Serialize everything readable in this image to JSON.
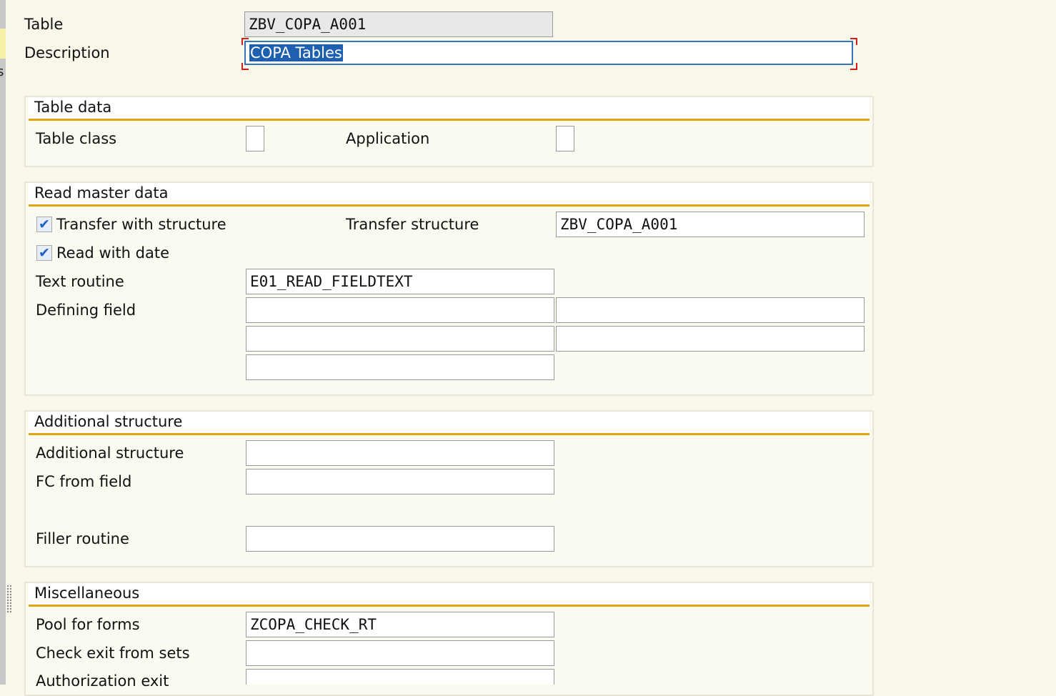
{
  "header": {
    "table_label": "Table",
    "table_value": "ZBV_COPA_A001",
    "description_label": "Description",
    "description_value": "COPA Tables"
  },
  "table_data": {
    "title": "Table data",
    "table_class_label": "Table class",
    "table_class_value": "",
    "application_label": "Application",
    "application_value": ""
  },
  "read_master_data": {
    "title": "Read master data",
    "transfer_with_structure_label": "Transfer with structure",
    "transfer_with_structure_checked": true,
    "read_with_date_label": "Read with date",
    "read_with_date_checked": true,
    "transfer_structure_label": "Transfer structure",
    "transfer_structure_value": "ZBV_COPA_A001",
    "text_routine_label": "Text routine",
    "text_routine_value": "E01_READ_FIELDTEXT",
    "defining_field_label": "Defining field",
    "defining_field_values": [
      "",
      "",
      "",
      "",
      ""
    ]
  },
  "additional_structure": {
    "title": "Additional structure",
    "additional_structure_label": "Additional structure",
    "additional_structure_value": "",
    "fc_from_field_label": "FC from field",
    "fc_from_field_value": "",
    "filler_routine_label": "Filler routine",
    "filler_routine_value": ""
  },
  "miscellaneous": {
    "title": "Miscellaneous",
    "pool_for_forms_label": "Pool for forms",
    "pool_for_forms_value": "ZCOPA_CHECK_RT",
    "check_exit_from_sets_label": "Check exit from sets",
    "check_exit_from_sets_value": "",
    "authorization_exit_label": "Authorization exit",
    "authorization_exit_value": ""
  },
  "sidebar": {
    "edge_text": "s"
  },
  "checkmark_glyph": "✔"
}
